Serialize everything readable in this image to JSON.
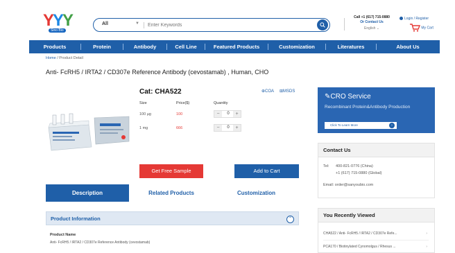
{
  "header": {
    "logo": {
      "letters": [
        "Y",
        "Y",
        "Y"
      ],
      "tagline": "Sino Bio"
    },
    "search": {
      "category": "All",
      "placeholder": "Enter Keywords"
    },
    "contact": {
      "phone": "Call +1 (617) 715-0880",
      "link": "Or Contact Us",
      "language": "English"
    },
    "login": "Login / Register",
    "cart": "My Cart"
  },
  "nav": [
    "Products",
    "Protein",
    "Antibody",
    "Cell Line",
    "Featured Products",
    "Customization",
    "Literatures",
    "About Us"
  ],
  "breadcrumb": {
    "home": "Home",
    "sep": "/",
    "current": "Product Detail"
  },
  "product": {
    "title": "Anti- FcRH5 / IRTA2 / CD307e Reference Antibody (cevostamab) , Human, CHO",
    "cat": "Cat:  CHA522",
    "coa": "COA",
    "msds": "MSDS",
    "table_headers": {
      "size": "Size",
      "price": "Price($)",
      "quantity": "Quantity"
    },
    "rows": [
      {
        "size": "100 µg",
        "price": "100",
        "qty": "0"
      },
      {
        "size": "1 mg",
        "price": "666",
        "qty": "0"
      }
    ],
    "sample_button": "Get Free Sample",
    "cart_button": "Add to Cart"
  },
  "tabs": [
    "Description",
    "Related Products",
    "Customization"
  ],
  "product_info": {
    "title": "Product Information",
    "name_label": "Product Name",
    "name_value": "Anti- FcRH5 / IRTA2 / CD307e Reference Antibody (cevostamab)"
  },
  "cro": {
    "heading": "CRO Service",
    "subtitle": "Recombinant Protein&Antibody Production",
    "button": "Click To Learn More"
  },
  "contact_panel": {
    "title": "Contact Us",
    "tel_label": "Tel:",
    "tel1": "400-821-0776 (China)",
    "tel2": "+1 (617) 715-0880 (Global)",
    "email": "Email: order@sanyoubio.com"
  },
  "recent_panel": {
    "title": "You Recently Viewed",
    "items": [
      "CHA522 / Anti- FcRH5 / IRTA2 / CD307e Refe...",
      "PCA170 / Biotinylated Cynomolgus / Rhesus ..."
    ]
  },
  "colors": {
    "brand_blue": "#1f5fa8",
    "accent_red": "#e53935",
    "cro_blue": "#2a66b3"
  }
}
